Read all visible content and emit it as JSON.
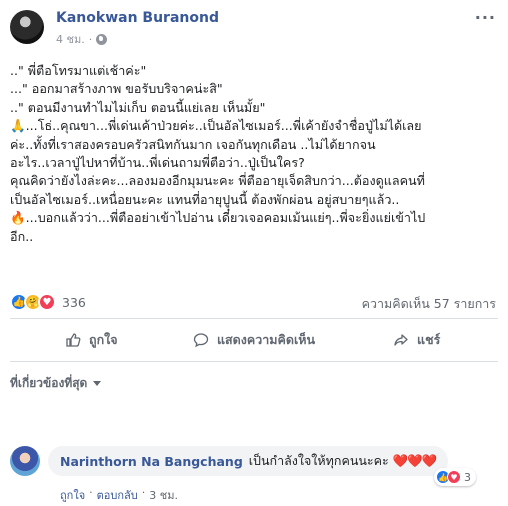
{
  "post": {
    "author": "Kanokwan Buranond",
    "time": "4 ชม.",
    "separator": "·",
    "more_label": "···",
    "lines": [
      "..\" พี่ตือโทรมาแต่เช้าค่ะ\"",
      "...\" ออกมาสร้างภาพ ขอรับบริจาคน่ะสิ\"",
      "..\" ตอนมีงานทำไมไม่เก็บ ตอนนี้แย่เลย เห็นมั้ย\"",
      "🙏...โธ่..คุณขา...พี่เด่นเค้าป่วยค่ะ..เป็นอัลไซเมอร์...พี่เค้ายังจำชื่อปู่ไม่ได้เลย",
      "ค่ะ..ทั้งที่เราสองครอบครัวสนิทกันมาก เจอกันทุกเดือน ..ไม่ได้ยากจน",
      "อะไร..เวลาปู่ไปหาที่บ้าน..พี่เด่นถามพี่ตือว่า..ปู่เป็นใคร?",
      "คุณคิดว่ายังไงล่ะคะ...ลองมองอีกมุมนะคะ พี่ตืออายุเจ็ดสิบกว่า...ต้องดูแลคนที่",
      "เป็นอัลไซเมอร์..เหนื่อยนะคะ แทนที่อายุปูนนี้ ต้องพักผ่อน อยู่สบายๆแล้ว..",
      "🔥...บอกแล้วว่า...พี่ตืออย่าเข้าไปอ่าน เดี๋ยวเจอคอมเม้นแย่ๆ..พี่จะยิ่งแย่เข้าไป",
      "อีก.."
    ]
  },
  "stats": {
    "reaction_count": "336",
    "comments": "ความคิดเห็น 57 รายการ"
  },
  "actions": {
    "like": "ถูกใจ",
    "comment": "แสดงความคิดเห็น",
    "share": "แชร์"
  },
  "filter": {
    "label": "ที่เกี่ยวข้องที่สุด"
  },
  "comment": {
    "author": "Narinthorn Na Bangchang",
    "text": "เป็นกำลังใจให้ทุกคนนะคะ",
    "hearts": "❤️❤️❤️",
    "reaction_count": "3",
    "like_label": "ถูกใจ",
    "reply_label": "ตอบกลับ",
    "time": "3 ชม.",
    "dot": "·"
  },
  "colors": {
    "link": "#385898",
    "muted": "#606770",
    "like_blue": "#1877f2",
    "love_red": "#f33e58",
    "care_yellow": "#f7b928"
  }
}
